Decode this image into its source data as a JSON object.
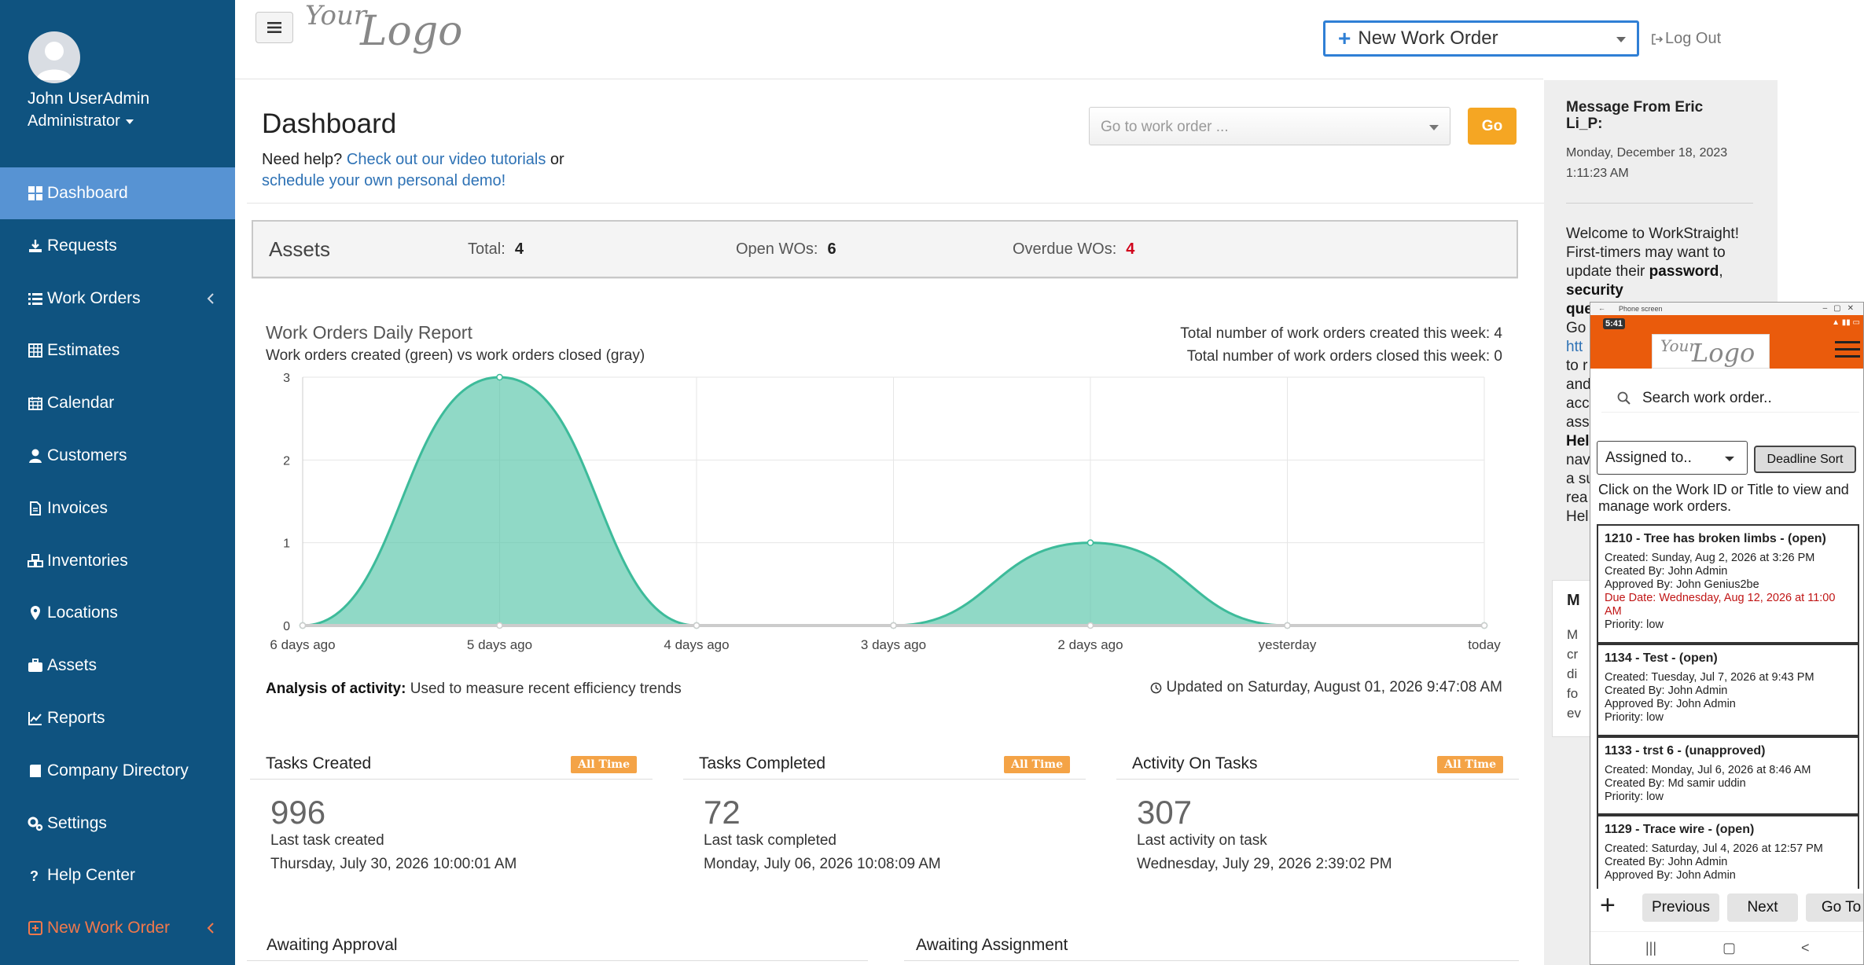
{
  "sidebar": {
    "user_name": "John UserAdmin",
    "user_role": "Administrator",
    "items": [
      {
        "label": "Dashboard",
        "icon": "grid-icon",
        "active": true
      },
      {
        "label": "Requests",
        "icon": "download-icon"
      },
      {
        "label": "Work Orders",
        "icon": "list-icon",
        "has_chevron": true
      },
      {
        "label": "Estimates",
        "icon": "table-icon"
      },
      {
        "label": "Calendar",
        "icon": "calendar-icon"
      },
      {
        "label": "Customers",
        "icon": "user-icon"
      },
      {
        "label": "Invoices",
        "icon": "file-icon"
      },
      {
        "label": "Inventories",
        "icon": "cubes-icon"
      },
      {
        "label": "Locations",
        "icon": "map-pin-icon"
      },
      {
        "label": "Assets",
        "icon": "briefcase-icon"
      },
      {
        "label": "Reports",
        "icon": "line-chart-icon"
      },
      {
        "label": "Company Directory",
        "icon": "book-icon"
      },
      {
        "label": "Settings",
        "icon": "gears-icon"
      },
      {
        "label": "Help Center",
        "icon": "question-icon"
      },
      {
        "label": "New Work Order",
        "icon": "plus-square-icon",
        "has_chevron": true,
        "accent": "#f2784b"
      }
    ]
  },
  "topbar": {
    "logo_text_1": "Your",
    "logo_text_2": "Logo",
    "new_work_order_label": "New Work Order",
    "logout_label": "Log Out"
  },
  "main": {
    "title": "Dashboard",
    "help_prefix": "Need help?",
    "help_link_1": "Check out our video tutorials",
    "help_mid": "or",
    "help_link_2": "schedule your own personal demo!",
    "goto_placeholder": "Go to work order ...",
    "go_label": "Go"
  },
  "assets": {
    "title": "Assets",
    "total_label": "Total:",
    "total_value": "4",
    "open_label": "Open WOs:",
    "open_value": "6",
    "overdue_label": "Overdue WOs:",
    "overdue_value": "4",
    "overdue_color": "#d0021b"
  },
  "report": {
    "title": "Work Orders Daily Report",
    "subtitle": "Work orders created (green) vs work orders closed (gray)",
    "created_week": "Total number of work orders created this week: 4",
    "closed_week": "Total number of work orders closed this week: 0",
    "analysis_label": "Analysis of activity:",
    "analysis_text": "Used to measure recent efficiency trends",
    "updated": "Updated on Saturday, August 01, 2026 9:47:08 AM"
  },
  "chart_data": {
    "type": "area",
    "categories": [
      "6 days ago",
      "5 days ago",
      "4 days ago",
      "3 days ago",
      "2 days ago",
      "yesterday",
      "today"
    ],
    "series": [
      {
        "name": "created",
        "values": [
          0,
          3,
          0,
          0,
          1,
          0,
          0
        ],
        "color": "#55c4a8"
      },
      {
        "name": "closed",
        "values": [
          0,
          0,
          0,
          0,
          0,
          0,
          0
        ],
        "color": "#cccccc"
      }
    ],
    "yticks": [
      "0",
      "1",
      "2",
      "3"
    ],
    "ylim": [
      0,
      3
    ],
    "grid": true
  },
  "cards": [
    {
      "title": "Tasks Created",
      "badge": "All Time",
      "value": "996",
      "sub": "Last task created",
      "ts": "Thursday, July 30, 2026 10:00:01 AM"
    },
    {
      "title": "Tasks Completed",
      "badge": "All Time",
      "value": "72",
      "sub": "Last task completed",
      "ts": "Monday, July 06, 2026 10:08:09 AM"
    },
    {
      "title": "Activity On Tasks",
      "badge": "All Time",
      "value": "307",
      "sub": "Last activity on task",
      "ts": "Wednesday, July 29, 2026 2:39:02 PM"
    }
  ],
  "awaiting": {
    "approval": "Awaiting Approval",
    "assignment": "Awaiting Assignment"
  },
  "message": {
    "from": "Message From Eric Li_P:",
    "date_line_1": "Monday, December 18, 2023",
    "date_line_2": "1:11:23 AM",
    "body_1": "Welcome to WorkStraight! First-timers may want to update their",
    "body_bold_1": "password",
    "body_sep": ",",
    "body_bold_2": "security",
    "frag_1": "que",
    "frag_2": "Go",
    "frag_3": "htt",
    "frag_4": "to r",
    "frag_5": "and",
    "frag_6": "acc",
    "frag_7": "ass",
    "frag_8": "Hel",
    "frag_9": "nav",
    "frag_10": "a su",
    "frag_11": "rea",
    "frag_12": "Hel",
    "card2_title": "M",
    "card2_frag_1": "M",
    "card2_frag_2": "cr",
    "card2_frag_3": "di",
    "card2_frag_4": "fo",
    "card2_frag_5": "ev"
  },
  "phone": {
    "window_title": "Phone screen",
    "clock": "5:41",
    "logo_text_1": "Your",
    "logo_text_2": "Logo",
    "search_placeholder": "Search work order..",
    "assigned_label": "Assigned to..",
    "deadline_label": "Deadline Sort",
    "hint": "Click on the Work ID or Title to view and manage work orders.",
    "work_orders": [
      {
        "title": "1210 - Tree has broken limbs - (open)",
        "lines": [
          "Created: Sunday, Aug 2, 2026 at 3:26 PM",
          "Created By: John Admin",
          "Approved By: John Genius2be"
        ],
        "due": "Due Date: Wednesday, Aug 12, 2026 at 11:00 AM",
        "priority": "Priority: low"
      },
      {
        "title": "1134 - Test - (open)",
        "lines": [
          "Created: Tuesday, Jul 7, 2026 at 9:43 PM",
          "Created By: John Admin",
          "Approved By: John Admin"
        ],
        "priority": "Priority: low"
      },
      {
        "title": "1133 - trst 6 - (unapproved)",
        "lines": [
          "Created: Monday, Jul 6, 2026 at 8:46 AM",
          "Created By: Md samir uddin"
        ],
        "priority": "Priority: low"
      },
      {
        "title": "1129 - Trace wire - (open)",
        "lines": [
          "Created: Saturday, Jul 4, 2026 at 12:57 PM",
          "Created By: John Admin",
          "Approved By: John Admin"
        ],
        "priority": ""
      }
    ],
    "previous_label": "Previous",
    "next_label": "Next",
    "goto_label": "Go To"
  }
}
